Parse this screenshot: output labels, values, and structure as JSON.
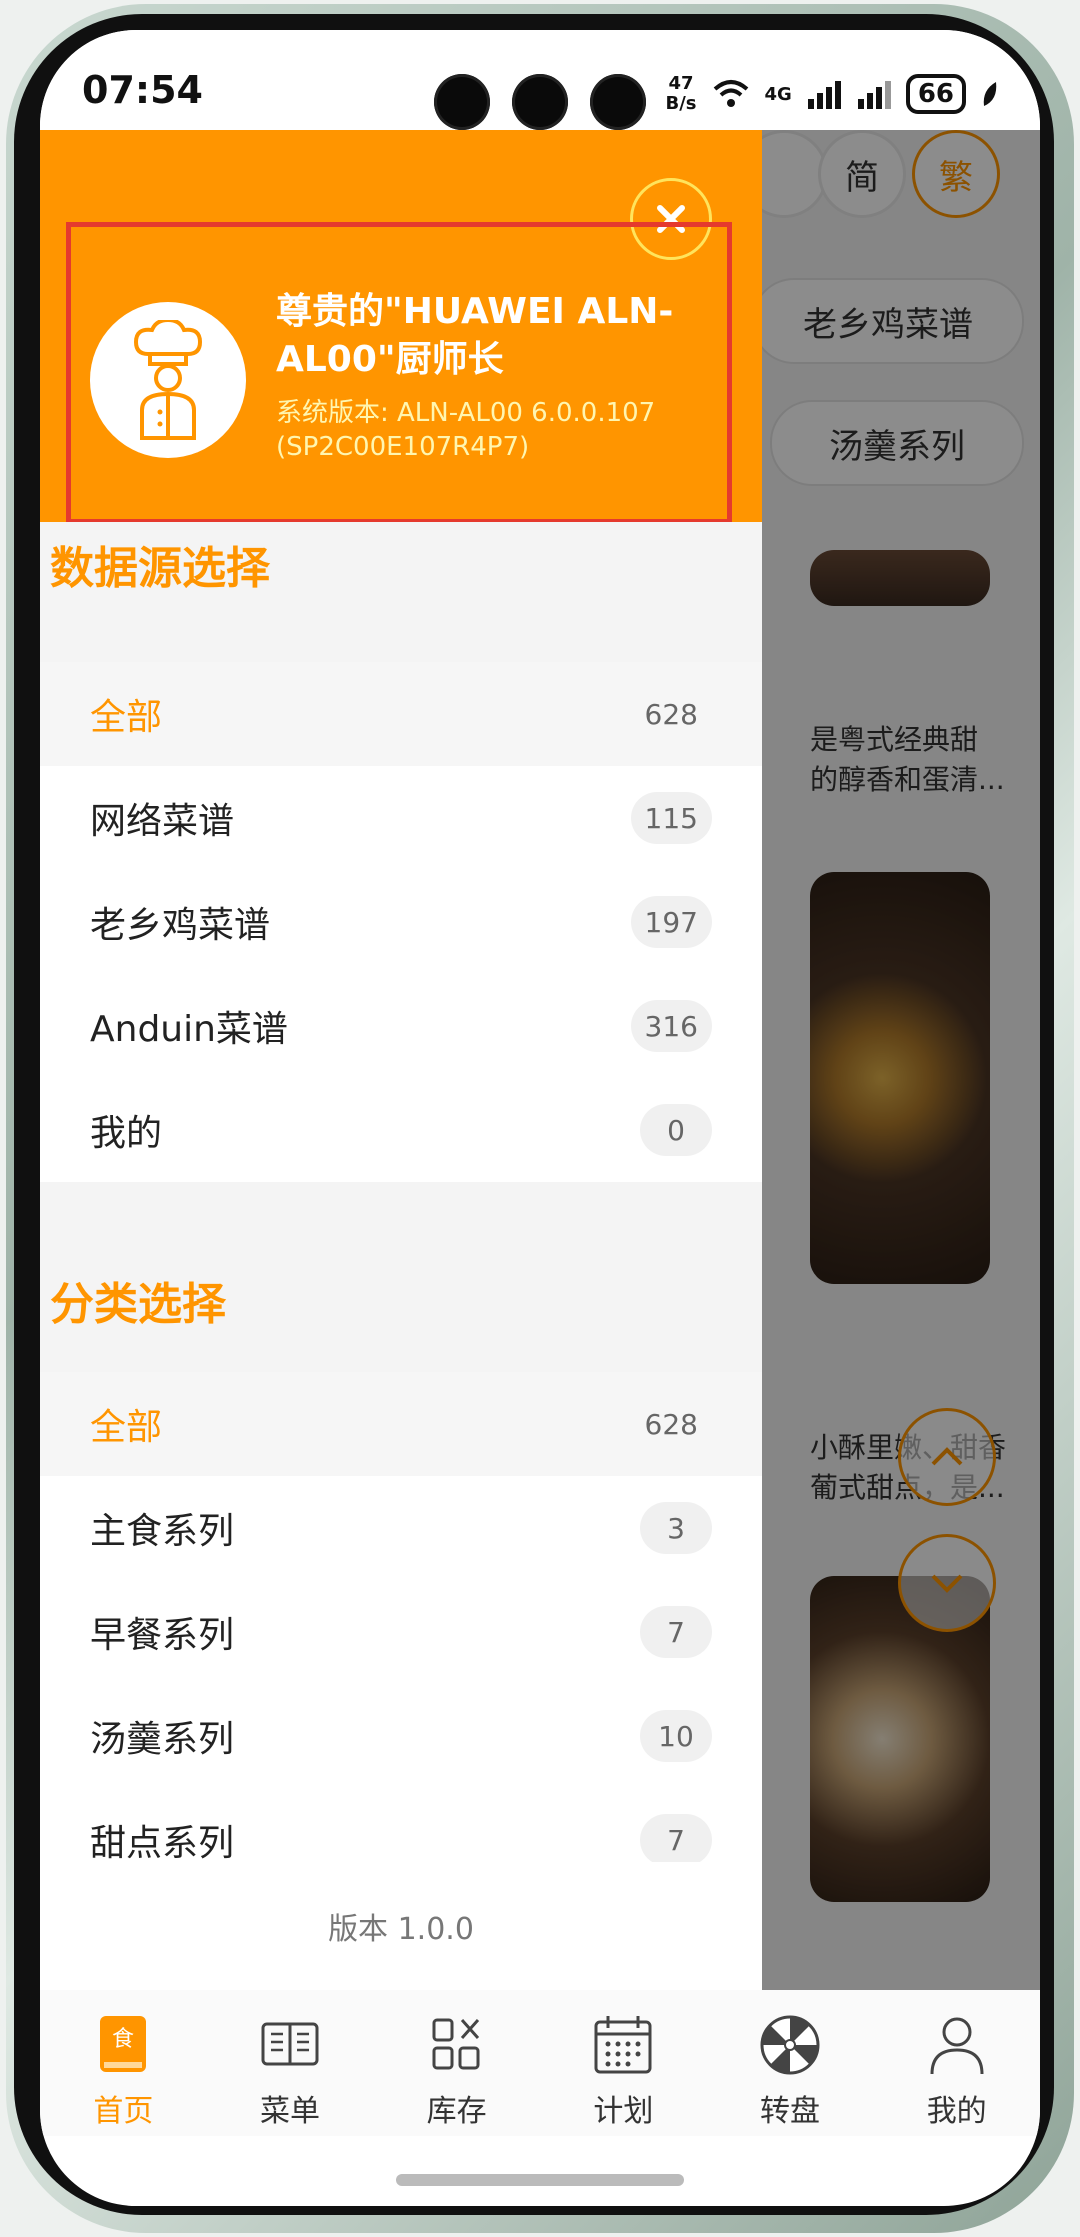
{
  "status_bar": {
    "time": "07:54",
    "net_speed_value": "47",
    "net_speed_unit": "B/s",
    "network": "4G",
    "battery": "66"
  },
  "background": {
    "lang_simplified": "简",
    "lang_traditional": "繁",
    "chip_1": "老乡鸡菜谱",
    "chip_2": "汤羹系列",
    "card_1_line1": "是粤式经典甜",
    "card_1_line2": "的醇香和蛋清...",
    "card_2_line1": "小酥里嫩、甜香",
    "card_2_line2": "葡式甜点，是..."
  },
  "drawer": {
    "user_title": "尊贵的\"HUAWEI ALN-AL00\"厨师长",
    "system_version": "系统版本: ALN-AL00 6.0.0.107 (SP2C00E107R4P7)",
    "datasource_title": "数据源选择",
    "datasource_items": [
      {
        "label": "全部",
        "count": "628"
      },
      {
        "label": "网络菜谱",
        "count": "115"
      },
      {
        "label": "老乡鸡菜谱",
        "count": "197"
      },
      {
        "label": "Anduin菜谱",
        "count": "316"
      },
      {
        "label": "我的",
        "count": "0"
      }
    ],
    "category_title": "分类选择",
    "category_items": [
      {
        "label": "全部",
        "count": "628"
      },
      {
        "label": "主食系列",
        "count": "3"
      },
      {
        "label": "早餐系列",
        "count": "7"
      },
      {
        "label": "汤羹系列",
        "count": "10"
      },
      {
        "label": "甜点系列",
        "count": "7"
      }
    ],
    "version": "版本 1.0.0"
  },
  "tabs": [
    {
      "label": "首页",
      "icon": "recipe-book-icon"
    },
    {
      "label": "菜单",
      "icon": "menu-icon"
    },
    {
      "label": "库存",
      "icon": "inventory-icon"
    },
    {
      "label": "计划",
      "icon": "calendar-icon"
    },
    {
      "label": "转盘",
      "icon": "wheel-icon"
    },
    {
      "label": "我的",
      "icon": "person-icon"
    }
  ],
  "colors": {
    "accent": "#ff9500",
    "highlight_box": "#e53a2e"
  }
}
